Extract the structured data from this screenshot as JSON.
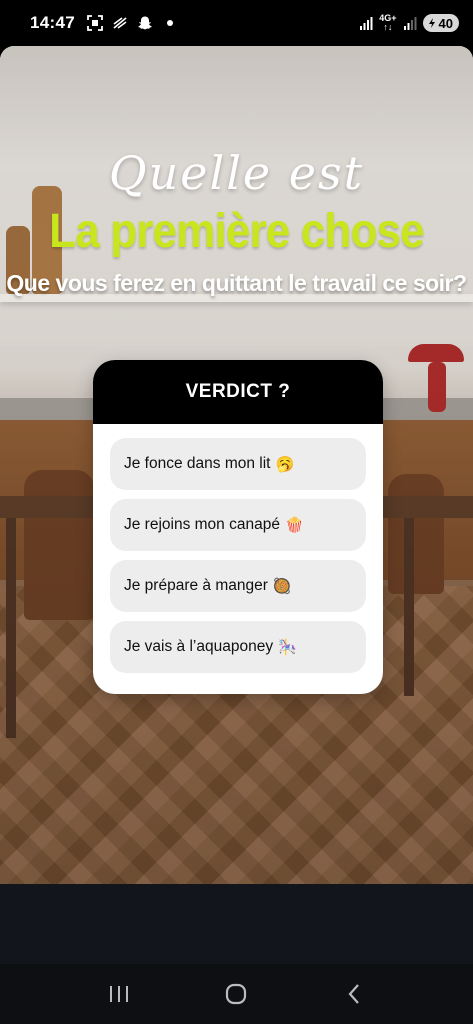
{
  "status_bar": {
    "time": "14:47",
    "network_label_top": "4G+",
    "battery": "40",
    "left_icons": [
      "screenshot-icon",
      "nfc-icon",
      "snapchat-icon",
      "notification-dot-icon"
    ],
    "right_icons": [
      "signal-icon",
      "signal-icon-2",
      "battery-icon"
    ]
  },
  "story": {
    "headline_line1": "Quelle est",
    "headline_line2": "La première chose",
    "headline_line3": "Que vous ferez en quittant le travail ce soir?",
    "headline_accent_color": "#c8e61e"
  },
  "poll": {
    "title": "VERDICT ?",
    "options": [
      {
        "label": "Je fonce dans mon lit",
        "emoji": "🥱"
      },
      {
        "label": "Je rejoins mon canapé",
        "emoji": "🍿"
      },
      {
        "label": "Je prépare à manger",
        "emoji": "🥘"
      },
      {
        "label": "Je vais à l’aquaponey",
        "emoji": "🎠"
      }
    ]
  },
  "navigation": {
    "icons": [
      "recent-apps-icon",
      "home-icon",
      "back-icon"
    ]
  }
}
